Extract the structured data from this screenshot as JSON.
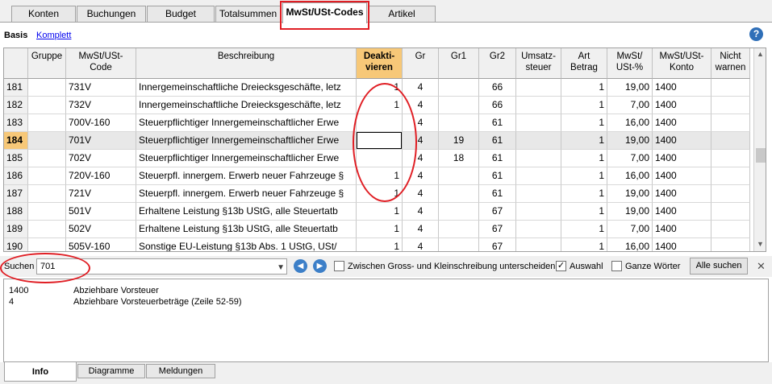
{
  "tabs": [
    "Konten",
    "Buchungen",
    "Budget",
    "Totalsummen",
    "MwSt/USt-Codes",
    "Artikel"
  ],
  "active_tab": "MwSt/USt-Codes",
  "views": {
    "basis": "Basis",
    "komplett": "Komplett"
  },
  "help_icon": "?",
  "columns": [
    "Gruppe",
    "MwSt/USt-Code",
    "Beschreibung",
    "Deakti-vieren",
    "Gr",
    "Gr1",
    "Gr2",
    "Umsatz-steuer",
    "Art Betrag",
    "MwSt/ USt-%",
    "MwSt/USt-Konto",
    "Nicht warnen"
  ],
  "rows": [
    {
      "n": "181",
      "code": "731V",
      "desc": "Innergemeinschaftliche Dreiecksgeschäfte, letz",
      "deakt": "1",
      "gr": "4",
      "gr1": "",
      "gr2": "66",
      "art": "1",
      "pct": "19,00",
      "konto": "1400"
    },
    {
      "n": "182",
      "code": "732V",
      "desc": "Innergemeinschaftliche Dreiecksgeschäfte, letz",
      "deakt": "1",
      "gr": "4",
      "gr1": "",
      "gr2": "66",
      "art": "1",
      "pct": "7,00",
      "konto": "1400"
    },
    {
      "n": "183",
      "code": "700V-160",
      "desc": "Steuerpflichtiger Innergemeinschaftlicher Erwe",
      "deakt": "",
      "gr": "4",
      "gr1": "",
      "gr2": "61",
      "art": "1",
      "pct": "16,00",
      "konto": "1400"
    },
    {
      "n": "184",
      "code": "701V",
      "desc": "Steuerpflichtiger Innergemeinschaftlicher Erwe",
      "deakt": "",
      "gr": "4",
      "gr1": "19",
      "gr2": "61",
      "art": "1",
      "pct": "19,00",
      "konto": "1400"
    },
    {
      "n": "185",
      "code": "702V",
      "desc": "Steuerpflichtiger Innergemeinschaftlicher Erwe",
      "deakt": "",
      "gr": "4",
      "gr1": "18",
      "gr2": "61",
      "art": "1",
      "pct": "7,00",
      "konto": "1400"
    },
    {
      "n": "186",
      "code": "720V-160",
      "desc": "Steuerpfl. innergem. Erwerb neuer Fahrzeuge §",
      "deakt": "1",
      "gr": "4",
      "gr1": "",
      "gr2": "61",
      "art": "1",
      "pct": "16,00",
      "konto": "1400"
    },
    {
      "n": "187",
      "code": "721V",
      "desc": "Steuerpfl. innergem. Erwerb neuer Fahrzeuge §",
      "deakt": "1",
      "gr": "4",
      "gr1": "",
      "gr2": "61",
      "art": "1",
      "pct": "19,00",
      "konto": "1400"
    },
    {
      "n": "188",
      "code": "501V",
      "desc": "Erhaltene Leistung §13b UStG, alle Steuertatb",
      "deakt": "1",
      "gr": "4",
      "gr1": "",
      "gr2": "67",
      "art": "1",
      "pct": "19,00",
      "konto": "1400"
    },
    {
      "n": "189",
      "code": "502V",
      "desc": "Erhaltene Leistung §13b UStG, alle Steuertatb",
      "deakt": "1",
      "gr": "4",
      "gr1": "",
      "gr2": "67",
      "art": "1",
      "pct": "7,00",
      "konto": "1400"
    },
    {
      "n": "190",
      "code": "505V-160",
      "desc": "Sonstige EU-Leistung §13b Abs. 1 UStG, USt/",
      "deakt": "1",
      "gr": "4",
      "gr1": "",
      "gr2": "67",
      "art": "1",
      "pct": "16,00",
      "konto": "1400"
    }
  ],
  "selected_row": "184",
  "search": {
    "label": "Suchen",
    "value": "701",
    "case_label": "Zwischen Gross- und Kleinschreibung unterscheiden",
    "case_checked": false,
    "auswahl_label": "Auswahl",
    "auswahl_checked": true,
    "ganze_label": "Ganze Wörter",
    "ganze_checked": false,
    "all_button": "Alle suchen"
  },
  "info_rows": [
    {
      "key": "1400",
      "value": "Abziehbare Vorsteuer"
    },
    {
      "key": "4",
      "value": "Abziehbare Vorsteuerbeträge (Zeile 52-59)"
    }
  ],
  "bottom_tabs": [
    "Info",
    "Diagramme",
    "Meldungen"
  ],
  "active_bottom_tab": "Info"
}
